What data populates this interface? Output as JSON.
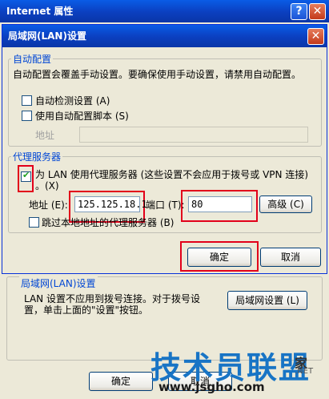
{
  "window": {
    "title": "Internet 属性",
    "help_glyph": "?",
    "close_glyph": "✕"
  },
  "dialog": {
    "title": "局域网(LAN)设置",
    "auto_config": {
      "legend": "自动配置",
      "description": "自动配置会覆盖手动设置。要确保使用手动设置，请禁用自动配置。",
      "auto_detect": {
        "label": "自动检测设置 (A)",
        "checked": false
      },
      "use_script": {
        "label": "使用自动配置脚本 (S)",
        "checked": false
      },
      "address_label": "地址",
      "address_value": ""
    },
    "proxy": {
      "legend": "代理服务器",
      "use_proxy": {
        "label": "为 LAN 使用代理服务器 (这些设置不会应用于拨号或 VPN 连接)",
        "label_line2": "。(X)",
        "checked": true
      },
      "address_label": "地址 (E):",
      "address_value": "125.125.18.1",
      "port_label": "端口 (T):",
      "port_value": "80",
      "advanced_button": "高级 (C)",
      "bypass_local": {
        "label": "跳过本地地址的代理服务器 (B)",
        "checked": false
      }
    },
    "ok_button": "确定",
    "cancel_button": "取消"
  },
  "lan_group": {
    "legend": "局域网(LAN)设置",
    "description_line1": "LAN 设置不应用到拨号连接。对于拨号设",
    "description_line2": "置，单击上面的\"设置\"按钮。",
    "button": "局域网设置 (L)"
  },
  "bottom_buttons": {
    "ok": "确定",
    "cancel": "取消"
  },
  "watermark": {
    "main": "技术员联盟",
    "suffix": "家",
    "url": "www.jsgho.com",
    "net": ".NET"
  }
}
